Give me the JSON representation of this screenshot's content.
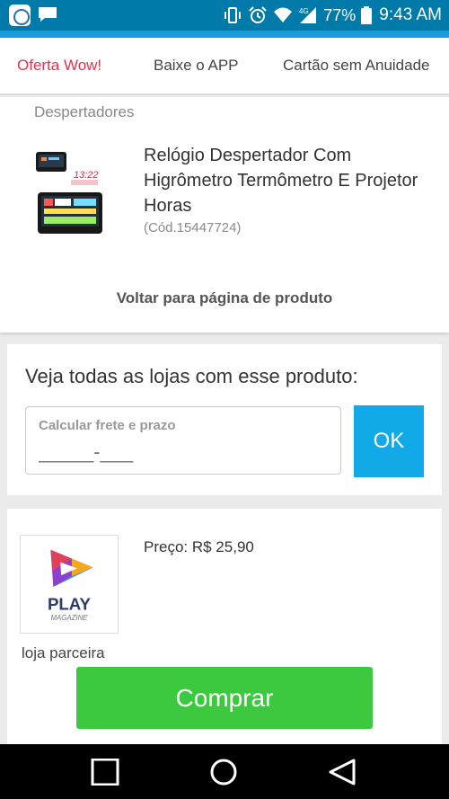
{
  "status_bar": {
    "network": "4G",
    "battery": "77%",
    "time": "9:43 AM",
    "icons": [
      "app-notification-icon",
      "message-icon",
      "vibrate-icon",
      "alarm-icon",
      "wifi-icon",
      "signal-icon",
      "battery-icon"
    ]
  },
  "tabs": [
    {
      "label": "Oferta Wow!",
      "active": true
    },
    {
      "label": "Baixe o APP",
      "active": false
    },
    {
      "label": "Cartão sem Anuidade",
      "active": false
    }
  ],
  "product": {
    "category": "Despertadores",
    "title": "Relógio Despertador Com Higrômetro Termômetro E Projetor Horas",
    "code": "(Cód.15447724)",
    "back_link": "Voltar para página de produto"
  },
  "stores": {
    "heading": "Veja todas as lojas com esse produto:",
    "freight_label": "Calcular frete e prazo",
    "freight_placeholder": "_____-___",
    "ok_label": "OK"
  },
  "offer": {
    "store_logo_text": "PLAY",
    "store_logo_subtext": "MAGAZINE",
    "store_type": "loja parceira",
    "price": "Preço: R$ 25,90",
    "buy_label": "Comprar"
  },
  "colors": {
    "status_bar": "#007aa8",
    "accent_blue": "#11a9e8",
    "active_tab": "#e0344f",
    "buy_green": "#3cc93f"
  }
}
